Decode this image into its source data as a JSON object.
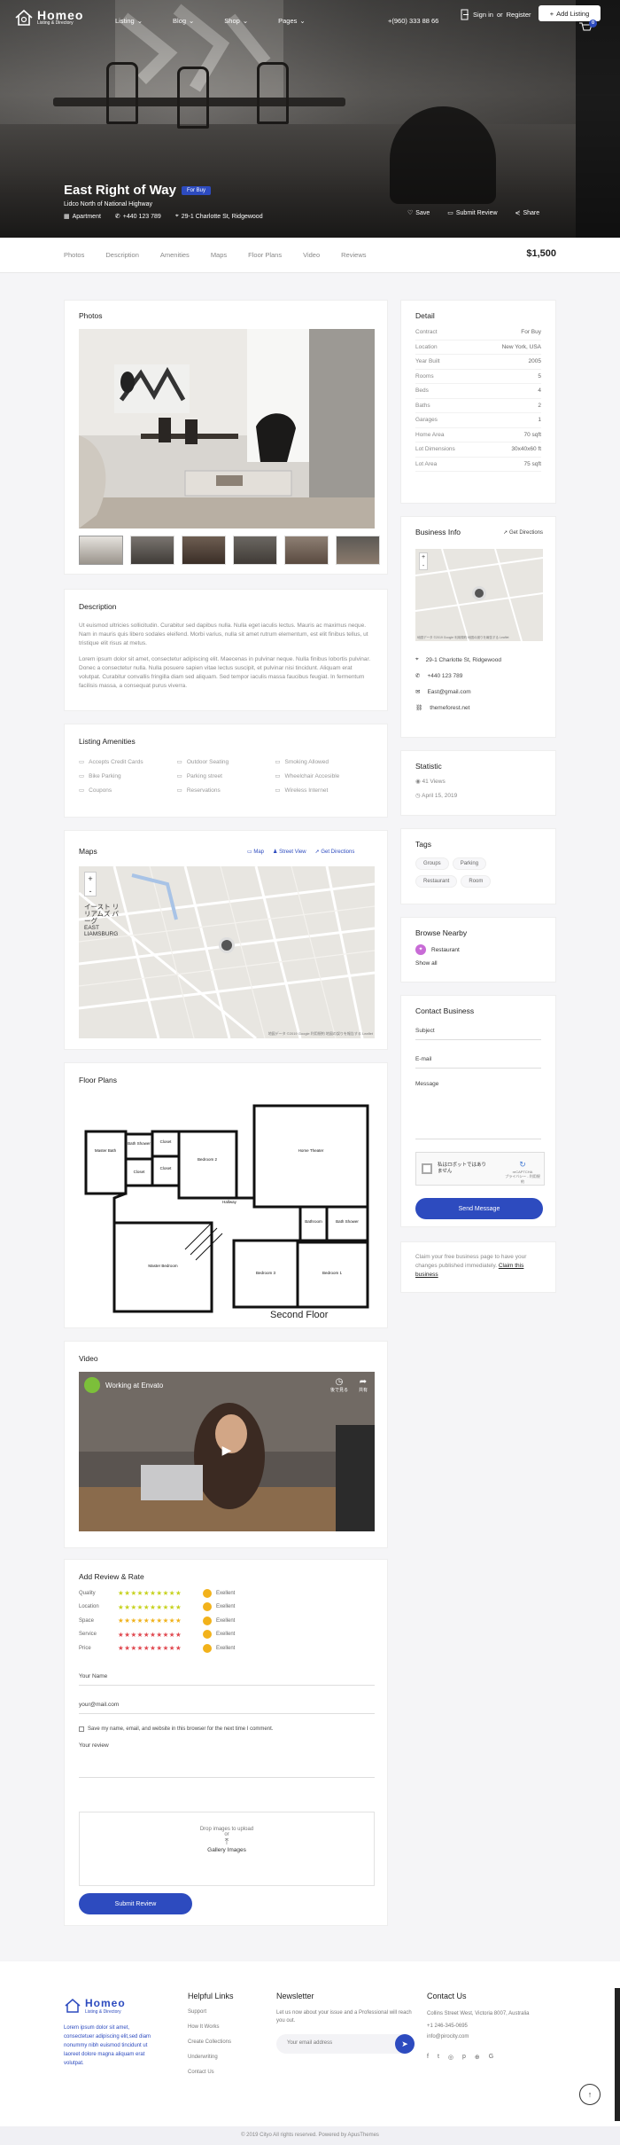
{
  "nav": {
    "logo_name": "Homeo",
    "logo_sub": "Listing & Directory",
    "menu": [
      "Listing",
      "Blog",
      "Shop",
      "Pages"
    ],
    "phone": "+(960) 333 88 66",
    "signin": "Sign in",
    "or": "or",
    "register": "Register",
    "add_listing": "Add Listing",
    "cart_count": "0"
  },
  "listing": {
    "title": "East Right of Way",
    "badge": "For Buy",
    "subtitle": "Lidco North of National Highway",
    "type": "Apartment",
    "phone": "+440 123 789",
    "address": "29-1 Charlotte St, Ridgewood",
    "save": "Save",
    "submit_review": "Submit Review",
    "share": "Share",
    "price": "$1,500"
  },
  "tabs": [
    "Photos",
    "Description",
    "Amenities",
    "Maps",
    "Floor Plans",
    "Video",
    "Reviews"
  ],
  "photos": {
    "heading": "Photos"
  },
  "description": {
    "heading": "Description",
    "p1": "Ut euismod ultricies sollicitudin. Curabitur sed dapibus nulla. Nulla eget iaculis lectus. Mauris ac maximus neque. Nam in mauris quis libero sodales eleifend. Morbi varius, nulla sit amet rutrum elementum, est elit finibus tellus, ut tristique elit risus at metus.",
    "p2": "Lorem ipsum dolor sit amet, consectetur adipiscing elit. Maecenas in pulvinar neque. Nulla finibus lobortis pulvinar. Donec a consectetur nulla. Nulla posuere sapien vitae lectus suscipit, et pulvinar nisi tincidunt. Aliquam erat volutpat. Curabitur convallis fringilla diam sed aliquam. Sed tempor iaculis massa faucibus feugiat. In fermentum facilisis massa, a consequat purus viverra."
  },
  "amenities": {
    "heading": "Listing Amenities",
    "items": [
      {
        "label": "Accepts Credit Cards",
        "icon": "credit-card-icon"
      },
      {
        "label": "Outdoor Seating",
        "icon": "seating-icon"
      },
      {
        "label": "Smoking Allowed",
        "icon": "smoking-icon"
      },
      {
        "label": "Bike Parking",
        "icon": "bike-icon"
      },
      {
        "label": "Parking street",
        "icon": "parking-icon"
      },
      {
        "label": "Wheelchair Accesible",
        "icon": "wheelchair-icon"
      },
      {
        "label": "Coupons",
        "icon": "coupon-icon"
      },
      {
        "label": "Reservations",
        "icon": "reservation-icon"
      },
      {
        "label": "Wireless Internet",
        "icon": "wifi-icon"
      }
    ]
  },
  "maps": {
    "heading": "Maps",
    "map": "Map",
    "street_view": "Street View",
    "directions": "Get Directions",
    "label_jp": "イースト リリアムズ バーグ",
    "label_en": "EAST LIAMSBURG",
    "attribution": "地図データ ©2019 Google   利用規約   地図の誤りを報告する   Leaflet"
  },
  "floor": {
    "heading": "Floor Plans",
    "caption": "Second Floor",
    "rooms": [
      "Master Bath",
      "Bath Shower",
      "Closet",
      "Bedroom 2",
      "Home Theater",
      "Closet",
      "Closet",
      "Hallway",
      "Bath Shower",
      "Bathroom",
      "Master Bedroom",
      "Bedroom 3",
      "Bedroom 1"
    ]
  },
  "video": {
    "heading": "Video",
    "title": "Working at Envato",
    "later": "後で見る",
    "share": "共有"
  },
  "review": {
    "heading": "Add Review & Rate",
    "criteria": [
      {
        "label": "Quality",
        "rating": "Exellent"
      },
      {
        "label": "Location",
        "rating": "Exellent"
      },
      {
        "label": "Space",
        "rating": "Exellent"
      },
      {
        "label": "Service",
        "rating": "Exellent"
      },
      {
        "label": "Price",
        "rating": "Exellent"
      }
    ],
    "name": "Your Name",
    "email": "your@mail.com",
    "save_label": "Save my name, email, and website in this browser for the next time I comment.",
    "review_label": "Your review",
    "drop": "Drop images to upload",
    "or": "or",
    "gallery": "Gallery Images",
    "submit": "Submit Review",
    "star_colors": [
      "#c7d21f",
      "#c7d21f",
      "#f0b21c",
      "#e0484f",
      "#e0484f"
    ]
  },
  "detail": {
    "heading": "Detail",
    "rows": [
      {
        "k": "Contract",
        "v": "For Buy"
      },
      {
        "k": "Location",
        "v": "New York, USA"
      },
      {
        "k": "Year Built",
        "v": "2005"
      },
      {
        "k": "Rooms",
        "v": "5"
      },
      {
        "k": "Beds",
        "v": "4"
      },
      {
        "k": "Baths",
        "v": "2"
      },
      {
        "k": "Garages",
        "v": "1"
      },
      {
        "k": "Home Area",
        "v": "70 sqft"
      },
      {
        "k": "Lot Dimensions",
        "v": "30x40x60 ft"
      },
      {
        "k": "Lot Area",
        "v": "75 sqft"
      }
    ]
  },
  "business": {
    "heading": "Business Info",
    "directions": "Get Directions",
    "attribution": "地図データ ©2019 Google   利用規約   地図の誤りを報告する   Leaflet",
    "address": "29-1 Charlotte St, Ridgewood",
    "phone": "+440 123 789",
    "email": "East@gmail.com",
    "site": "themeforest.net"
  },
  "statistic": {
    "heading": "Statistic",
    "views": "41 Views",
    "date": "April 15, 2019"
  },
  "tags": {
    "heading": "Tags",
    "items": [
      "Groups",
      "Parking",
      "Restaurant",
      "Room"
    ]
  },
  "nearby": {
    "heading": "Browse Nearby",
    "item": "Restaurant",
    "show_all": "Show all"
  },
  "contact": {
    "heading": "Contact Business",
    "subject": "Subject",
    "email": "E-mail",
    "message": "Message",
    "captcha": "私はロボットではありません",
    "captcha_brand": "reCAPTCHA",
    "captcha_terms": "プライバシー - 利用規約",
    "send": "Send Message"
  },
  "claim": {
    "text": "Claim your free business page to have your changes published immediately.",
    "link": "Claim this business"
  },
  "footer": {
    "logo_name": "Homeo",
    "logo_sub": "Listing & Directory",
    "about": "Lorem ipsum dolor sit amet, consectetuer adipiscing elit,sed diam nonummy nibh euismod tincidunt ut laoreet dolore magna aliquam erat volutpat.",
    "links_heading": "Helpful Links",
    "links": [
      "Support",
      "How It Works",
      "Create Collections",
      "Underwriting",
      "Contact Us"
    ],
    "news_heading": "Newsletter",
    "news_text": "Let us now about your issue and a Professional will reach you out.",
    "news_placeholder": "Your email address",
    "contact_heading": "Contact Us",
    "address": "Collins Street West, Victoria 8007, Australia",
    "phone": "+1 246-345-0695",
    "email": "info@pirocity.com",
    "copyright": "© 2019 Cityo All rights reserved. Powered by ApusThemes"
  },
  "colors": {
    "accent": "#2d4bbf",
    "star_yellow": "#c7d21f",
    "star_red": "#e0484f"
  }
}
